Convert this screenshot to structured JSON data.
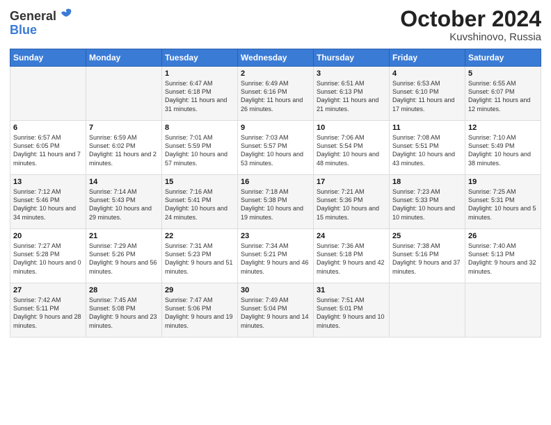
{
  "header": {
    "logo_general": "General",
    "logo_blue": "Blue",
    "title": "October 2024",
    "location": "Kuvshinovo, Russia"
  },
  "weekdays": [
    "Sunday",
    "Monday",
    "Tuesday",
    "Wednesday",
    "Thursday",
    "Friday",
    "Saturday"
  ],
  "weeks": [
    [
      {
        "day": "",
        "content": ""
      },
      {
        "day": "",
        "content": ""
      },
      {
        "day": "1",
        "content": "Sunrise: 6:47 AM\nSunset: 6:18 PM\nDaylight: 11 hours\nand 31 minutes."
      },
      {
        "day": "2",
        "content": "Sunrise: 6:49 AM\nSunset: 6:16 PM\nDaylight: 11 hours\nand 26 minutes."
      },
      {
        "day": "3",
        "content": "Sunrise: 6:51 AM\nSunset: 6:13 PM\nDaylight: 11 hours\nand 21 minutes."
      },
      {
        "day": "4",
        "content": "Sunrise: 6:53 AM\nSunset: 6:10 PM\nDaylight: 11 hours\nand 17 minutes."
      },
      {
        "day": "5",
        "content": "Sunrise: 6:55 AM\nSunset: 6:07 PM\nDaylight: 11 hours\nand 12 minutes."
      }
    ],
    [
      {
        "day": "6",
        "content": "Sunrise: 6:57 AM\nSunset: 6:05 PM\nDaylight: 11 hours\nand 7 minutes."
      },
      {
        "day": "7",
        "content": "Sunrise: 6:59 AM\nSunset: 6:02 PM\nDaylight: 11 hours\nand 2 minutes."
      },
      {
        "day": "8",
        "content": "Sunrise: 7:01 AM\nSunset: 5:59 PM\nDaylight: 10 hours\nand 57 minutes."
      },
      {
        "day": "9",
        "content": "Sunrise: 7:03 AM\nSunset: 5:57 PM\nDaylight: 10 hours\nand 53 minutes."
      },
      {
        "day": "10",
        "content": "Sunrise: 7:06 AM\nSunset: 5:54 PM\nDaylight: 10 hours\nand 48 minutes."
      },
      {
        "day": "11",
        "content": "Sunrise: 7:08 AM\nSunset: 5:51 PM\nDaylight: 10 hours\nand 43 minutes."
      },
      {
        "day": "12",
        "content": "Sunrise: 7:10 AM\nSunset: 5:49 PM\nDaylight: 10 hours\nand 38 minutes."
      }
    ],
    [
      {
        "day": "13",
        "content": "Sunrise: 7:12 AM\nSunset: 5:46 PM\nDaylight: 10 hours\nand 34 minutes."
      },
      {
        "day": "14",
        "content": "Sunrise: 7:14 AM\nSunset: 5:43 PM\nDaylight: 10 hours\nand 29 minutes."
      },
      {
        "day": "15",
        "content": "Sunrise: 7:16 AM\nSunset: 5:41 PM\nDaylight: 10 hours\nand 24 minutes."
      },
      {
        "day": "16",
        "content": "Sunrise: 7:18 AM\nSunset: 5:38 PM\nDaylight: 10 hours\nand 19 minutes."
      },
      {
        "day": "17",
        "content": "Sunrise: 7:21 AM\nSunset: 5:36 PM\nDaylight: 10 hours\nand 15 minutes."
      },
      {
        "day": "18",
        "content": "Sunrise: 7:23 AM\nSunset: 5:33 PM\nDaylight: 10 hours\nand 10 minutes."
      },
      {
        "day": "19",
        "content": "Sunrise: 7:25 AM\nSunset: 5:31 PM\nDaylight: 10 hours\nand 5 minutes."
      }
    ],
    [
      {
        "day": "20",
        "content": "Sunrise: 7:27 AM\nSunset: 5:28 PM\nDaylight: 10 hours\nand 0 minutes."
      },
      {
        "day": "21",
        "content": "Sunrise: 7:29 AM\nSunset: 5:26 PM\nDaylight: 9 hours\nand 56 minutes."
      },
      {
        "day": "22",
        "content": "Sunrise: 7:31 AM\nSunset: 5:23 PM\nDaylight: 9 hours\nand 51 minutes."
      },
      {
        "day": "23",
        "content": "Sunrise: 7:34 AM\nSunset: 5:21 PM\nDaylight: 9 hours\nand 46 minutes."
      },
      {
        "day": "24",
        "content": "Sunrise: 7:36 AM\nSunset: 5:18 PM\nDaylight: 9 hours\nand 42 minutes."
      },
      {
        "day": "25",
        "content": "Sunrise: 7:38 AM\nSunset: 5:16 PM\nDaylight: 9 hours\nand 37 minutes."
      },
      {
        "day": "26",
        "content": "Sunrise: 7:40 AM\nSunset: 5:13 PM\nDaylight: 9 hours\nand 32 minutes."
      }
    ],
    [
      {
        "day": "27",
        "content": "Sunrise: 7:42 AM\nSunset: 5:11 PM\nDaylight: 9 hours\nand 28 minutes."
      },
      {
        "day": "28",
        "content": "Sunrise: 7:45 AM\nSunset: 5:08 PM\nDaylight: 9 hours\nand 23 minutes."
      },
      {
        "day": "29",
        "content": "Sunrise: 7:47 AM\nSunset: 5:06 PM\nDaylight: 9 hours\nand 19 minutes."
      },
      {
        "day": "30",
        "content": "Sunrise: 7:49 AM\nSunset: 5:04 PM\nDaylight: 9 hours\nand 14 minutes."
      },
      {
        "day": "31",
        "content": "Sunrise: 7:51 AM\nSunset: 5:01 PM\nDaylight: 9 hours\nand 10 minutes."
      },
      {
        "day": "",
        "content": ""
      },
      {
        "day": "",
        "content": ""
      }
    ]
  ]
}
